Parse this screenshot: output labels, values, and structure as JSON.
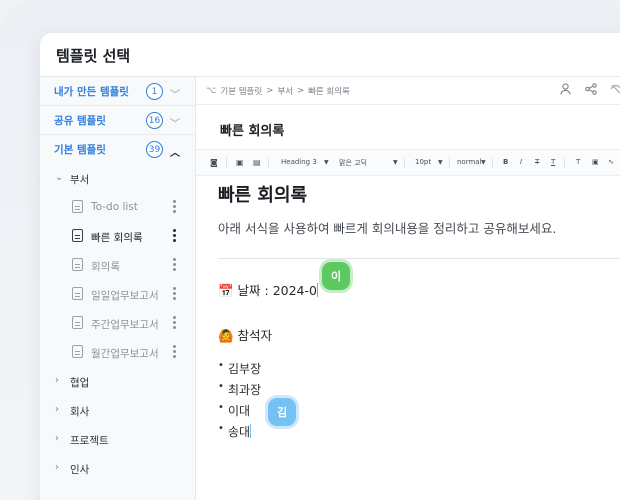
{
  "window": {
    "title": "템플릿 선택"
  },
  "sidebar": {
    "groups": [
      {
        "label": "내가 만든 템플릿",
        "count": "1"
      },
      {
        "label": "공유 템플릿",
        "count": "16"
      },
      {
        "label": "기본 템플릿",
        "count": "39"
      }
    ],
    "folders": [
      {
        "label": "부서"
      },
      {
        "label": "협업"
      },
      {
        "label": "회사"
      },
      {
        "label": "프로젝트"
      },
      {
        "label": "인사"
      }
    ],
    "templates": [
      {
        "label": "To-do list"
      },
      {
        "label": "빠른 회의록"
      },
      {
        "label": "회의록"
      },
      {
        "label": "일일업무보고서"
      },
      {
        "label": "주간업무보고서"
      },
      {
        "label": "월간업무보고서"
      }
    ]
  },
  "breadcrumb": {
    "items": [
      "기본 템플릿",
      "부서",
      "빠른 회의록"
    ],
    "sep": ">"
  },
  "document": {
    "title": "빠른 회의록",
    "heading": "빠른 회의록",
    "intro": "아래 서식을 사용하여 빠르게 회의내용을 정리하고 공유해보세요.",
    "date_line": "📅 날짜 : 2024-0",
    "attendees_label": "🙆 참석자",
    "attendees": [
      "김부장",
      "최과장",
      "이대",
      "송대"
    ]
  },
  "toolbar": {
    "heading": "Heading 3",
    "font": "맑은 고딕",
    "size": "10pt",
    "spacing": "normal"
  },
  "collaborators": {
    "user1": {
      "initial": "이",
      "color": "#5ec962"
    },
    "user2": {
      "initial": "김",
      "color": "#74c2f3"
    }
  },
  "colors": {
    "accent": "#2f7fe0"
  }
}
